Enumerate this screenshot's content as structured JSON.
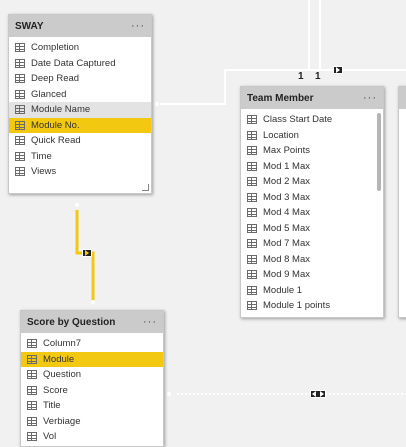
{
  "tables": {
    "sway": {
      "title": "SWAY",
      "more": "···",
      "fields": [
        "Completion",
        "Date Data Captured",
        "Deep Read",
        "Glanced",
        "Module Name",
        "Module No.",
        "Quick Read",
        "Time",
        "Views"
      ],
      "hover_field": "Module Name",
      "selected_field": "Module No."
    },
    "team_member": {
      "title": "Team Member",
      "more": "···",
      "fields": [
        "Class Start Date",
        "Location",
        "Max Points",
        "Mod 1 Max",
        "Mod 2 Max",
        "Mod 3 Max",
        "Mod 4 Max",
        "Mod 5 Max",
        "Mod 7 Max",
        "Mod 8 Max",
        "Mod 9 Max",
        "Module 1",
        "Module 1 points"
      ]
    },
    "score_by_question": {
      "title": "Score by Question",
      "more": "···",
      "fields": [
        "Column7",
        "Module",
        "Question",
        "Score",
        "Title",
        "Verbiage",
        "Vol"
      ],
      "selected_field": "Module"
    }
  },
  "relationships": {
    "one_label": "1",
    "many_label": "*"
  },
  "colors": {
    "canvas": "#f1f1f1",
    "selected": "#f2c811",
    "header": "#cbcbcb",
    "line": "#ffffff"
  }
}
